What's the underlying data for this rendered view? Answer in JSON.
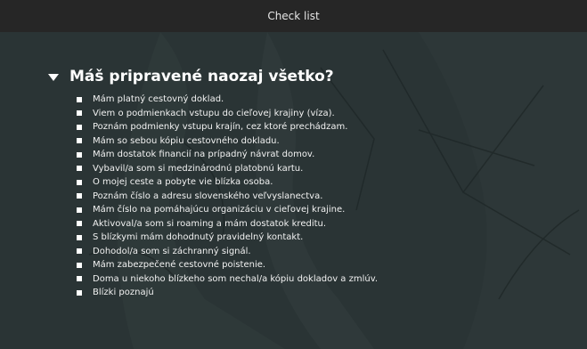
{
  "window": {
    "title": "Check list"
  },
  "checklist": {
    "heading": "Máš pripravené naozaj všetko?",
    "items": [
      "Mám platný cestovný doklad.",
      "Viem o podmienkach vstupu do cieľovej krajiny (víza).",
      "Poznám podmienky vstupu krajín, cez ktoré prechádzam.",
      "Mám so sebou kópiu cestovného dokladu.",
      "Mám dostatok financií na prípadný návrat domov.",
      "Vybavil/a som si medzinárodnú platobnú kartu.",
      "O mojej ceste a pobyte vie blízka osoba.",
      "Poznám číslo a adresu slovenského veľvyslanectva.",
      "Mám číslo na pomáhajúcu organizáciu v cieľovej krajine.",
      "Aktivoval/a som si roaming a mám dostatok kreditu.",
      "S blízkymi mám dohodnutý pravidelný kontakt.",
      "Dohodol/a som si záchranný signál.",
      "Mám zabezpečené cestovné poistenie.",
      "Doma u niekoho blízkeho som nechal/a kópiu dokladov a zmlúv.",
      "Blízki poznajú"
    ]
  },
  "colors": {
    "titlebar": "#262626",
    "background": "#2f3a3b",
    "text": "#ffffff"
  }
}
